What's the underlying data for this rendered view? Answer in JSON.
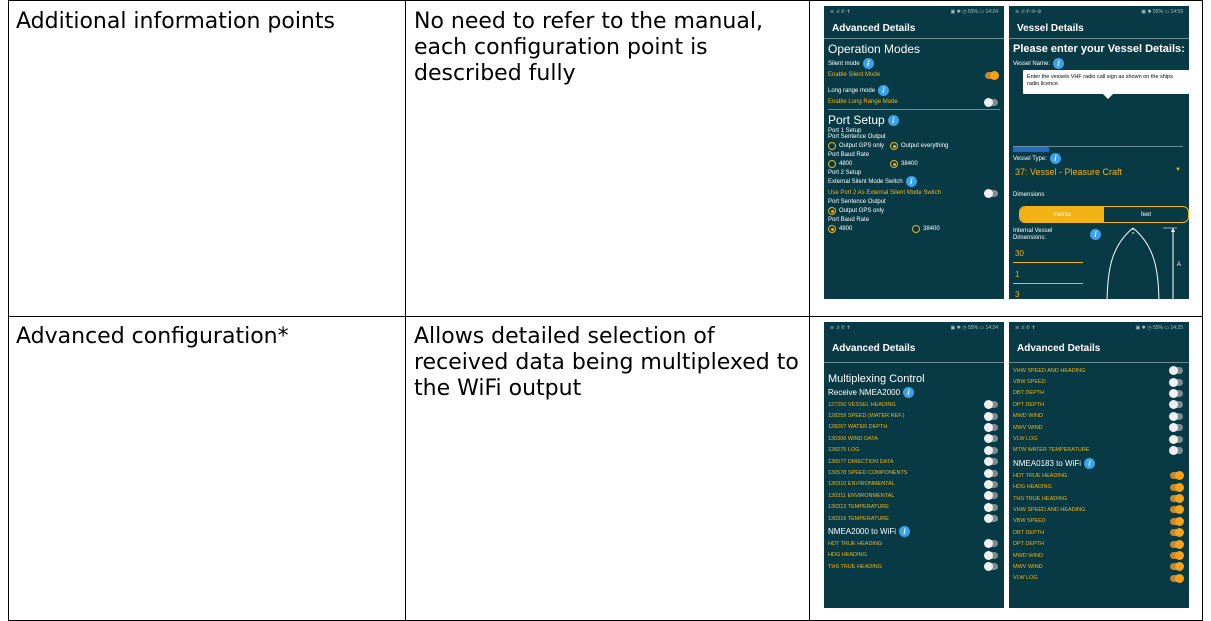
{
  "rows": [
    {
      "feature": "Additional information points",
      "description": "No need to refer to the manual, each configuration point is described fully"
    },
    {
      "feature": "Advanced configuration*",
      "description": "Allows detailed selection of received data being multiplexed to the WiFi output"
    }
  ],
  "screens": {
    "advanced1": {
      "status_left": "≋ .ıl ✆ ✝",
      "status_right": "▣ ✱ ◷ 55% ▭ 14:24",
      "title": "Advanced Details",
      "operation_modes": "Operation Modes",
      "silent_mode": "Silent mode",
      "enable_silent": "Enable Silent Mode",
      "long_range_mode": "Long range mode",
      "enable_long_range": "Enable Long Range Mode",
      "port_setup": "Port Setup",
      "port1_setup": "Port 1 Setup",
      "port_sentence_output": "Port Sentence Output",
      "output_gps_only": "Output GPS only",
      "output_everything": "Output everything",
      "port_baud_rate": "Port Baud Rate",
      "baud_4800": "4800",
      "baud_38400": "38400",
      "port2_setup": "Port 2 Setup",
      "ext_silent_switch": "External Silent Mode Switch",
      "use_port2": "Use Port 2 As External Silent Mode Switch",
      "port_sentence_output_2": "Port Sentence Output",
      "output_gps_only_2": "Output GPS only",
      "port_baud_rate_2": "Port Baud Rate",
      "baud_4800_2": "4800",
      "baud_38400_2": "38400"
    },
    "vessel": {
      "status_left": "≋ .ıl ✆ ✉ ⚙",
      "status_right": "▣ ✱ 55% ▭ 14:59",
      "title": "Vessel Details",
      "heading": "Please enter your Vessel Details:",
      "vessel_name": "Vessel Name:",
      "tooltip": "Enter the vessels VHF radio call sign as shown on the ships radio licence",
      "vessel_type": "Vessel Type:",
      "vessel_type_value": "37: Vessel - Pleasure Craft",
      "dimensions": "Dimensions",
      "metres": "metres",
      "feet": "feet",
      "internal_dims": "Internal Vessel Dimensions:",
      "dim_a": "30",
      "dim_b": "1",
      "dim_c": "3",
      "label_a": "A"
    },
    "multiplex1": {
      "status_left": "≋ .ıl ✆ ✝",
      "status_right": "▣ ✱ ◷ 55% ▭ 14:24",
      "title": "Advanced Details",
      "section": "Multiplexing Control",
      "receive": "Receive NMEA2000",
      "items": [
        "127250 VESSEL HEADING",
        "128259 SPEED (WATER REF.)",
        "128267 WATER DEPTH",
        "130306 WIND DATA",
        "128275 LOG",
        "130577 DIRECTION DATA",
        "130578 SPEED COMPONENTS",
        "130310 ENVIRONMENTAL",
        "130311 ENVIRONMENTAL",
        "130312 TEMPERATURE",
        "130316 TEMPERATURE"
      ],
      "to_wifi": "NMEA2000 to WiFi",
      "wifi_items": [
        "HDT TRUE HEADING",
        "HDG HEADING",
        "THS TRUE HEADING"
      ]
    },
    "multiplex2": {
      "status_left": "≋ .ıl ✆ ✝",
      "status_right": "▣ ✱ ◷ 55% ▭ 14:25",
      "title": "Advanced Details",
      "items_off": [
        "VHW SPEED AND HEADING",
        "VBW SPEED",
        "DBT DEPTH",
        "DPT DEPTH",
        "MWD WIND",
        "MWV WIND",
        "VLW LOG",
        "MTW WATER TEMPERATURE"
      ],
      "to_wifi": "NMEA0183 to WiFi",
      "items_on": [
        "HDT TRUE HEADING",
        "HDG HEADING",
        "THS TRUE HEADING",
        "VHW SPEED AND HEADING",
        "VBW SPEED",
        "DBT DEPTH",
        "DPT DEPTH",
        "MWD WIND",
        "MWV WIND",
        "VLW LOG"
      ]
    }
  }
}
